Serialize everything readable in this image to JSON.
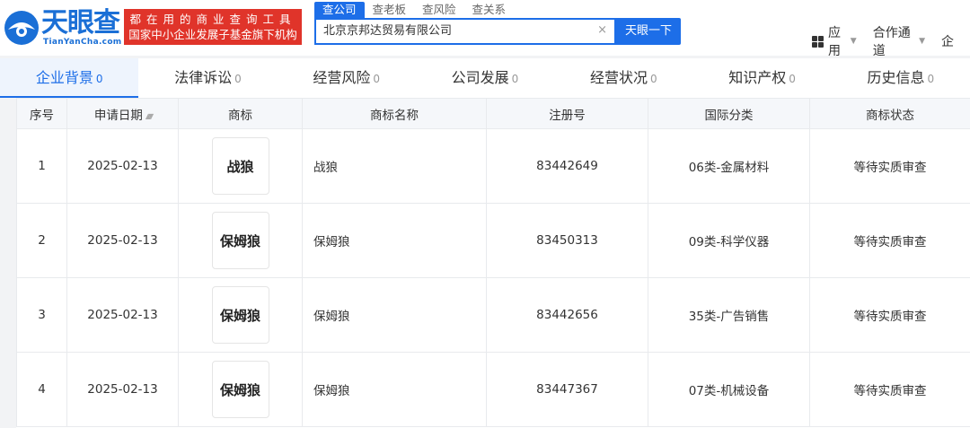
{
  "brand": {
    "name": "天眼查",
    "domain": "TianYanCha.com",
    "slogan_line1": "都在用的商业查询工具",
    "slogan_line2": "国家中小企业发展子基金旗下机构"
  },
  "search": {
    "tabs": [
      "查公司",
      "查老板",
      "查风险",
      "查关系"
    ],
    "active_tab": 0,
    "value": "北京京邦达贸易有限公司",
    "clear": "×",
    "button": "天眼一下"
  },
  "nav": {
    "apps": "应用",
    "partners": "合作通道",
    "truncated": "企"
  },
  "tabs": [
    {
      "label": "企业背景",
      "count": "0"
    },
    {
      "label": "法律诉讼",
      "count": "0"
    },
    {
      "label": "经营风险",
      "count": "0"
    },
    {
      "label": "公司发展",
      "count": "0"
    },
    {
      "label": "经营状况",
      "count": "0"
    },
    {
      "label": "知识产权",
      "count": "0"
    },
    {
      "label": "历史信息",
      "count": "0"
    }
  ],
  "table": {
    "headers": [
      "序号",
      "申请日期",
      "商标",
      "商标名称",
      "注册号",
      "国际分类",
      "商标状态"
    ],
    "rows": [
      {
        "index": "1",
        "date": "2025-02-13",
        "mark": "战狼",
        "name": "战狼",
        "reg_no": "83442649",
        "class": "06类-金属材料",
        "status": "等待实质审查"
      },
      {
        "index": "2",
        "date": "2025-02-13",
        "mark": "保姆狼",
        "name": "保姆狼",
        "reg_no": "83450313",
        "class": "09类-科学仪器",
        "status": "等待实质审查"
      },
      {
        "index": "3",
        "date": "2025-02-13",
        "mark": "保姆狼",
        "name": "保姆狼",
        "reg_no": "83442656",
        "class": "35类-广告销售",
        "status": "等待实质审查"
      },
      {
        "index": "4",
        "date": "2025-02-13",
        "mark": "保姆狼",
        "name": "保姆狼",
        "reg_no": "83447367",
        "class": "07类-机械设备",
        "status": "等待实质审查"
      }
    ]
  },
  "colors": {
    "brand_blue": "#1d6ee8",
    "slogan_red": "#e0342a"
  }
}
